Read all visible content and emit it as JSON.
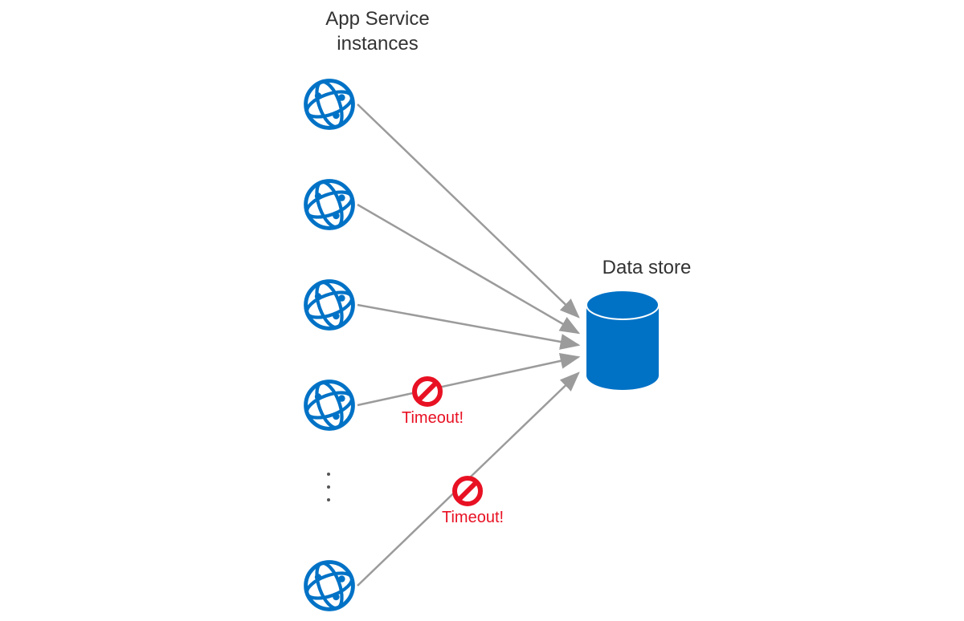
{
  "labels": {
    "app_service": "App Service\ninstances",
    "data_store": "Data store",
    "timeout1": "Timeout!",
    "timeout2": "Timeout!"
  },
  "colors": {
    "azure_blue": "#0072c6",
    "error_red": "#e81123",
    "arrow_gray": "#9b9b9b"
  },
  "diagram": {
    "source_instances": 5,
    "target": "datastore",
    "blocked_connections": [
      3,
      4
    ]
  }
}
